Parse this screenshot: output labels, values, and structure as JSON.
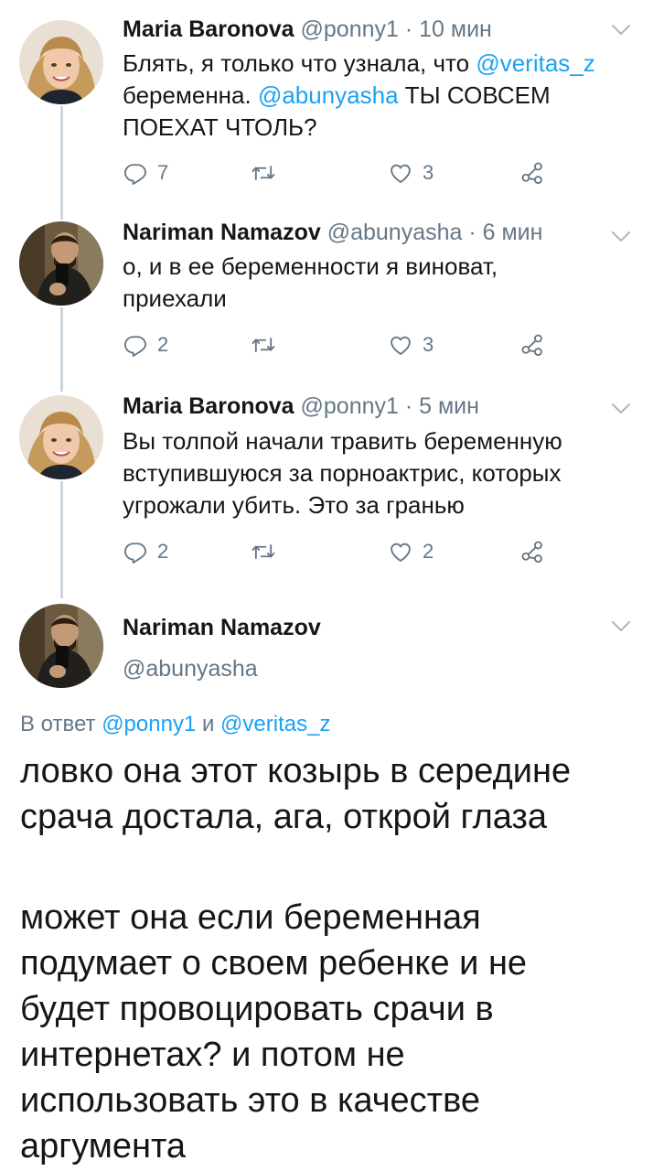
{
  "tweets": [
    {
      "name": "Maria Baronova",
      "handle": "@ponny1",
      "time": "· 10 мин",
      "text_parts": [
        "Блять, я только что узнала, что ",
        "@veritas_z",
        " беременна. ",
        "@abunyasha",
        " ТЫ СОВСЕМ ПОЕХАТ ЧТОЛЬ?"
      ],
      "replies": "7",
      "retweets": "",
      "likes": "3"
    },
    {
      "name": "Nariman Namazov",
      "handle": "@abunyasha",
      "time": "· 6 мин",
      "text": "о, и в ее беременности я виноват, приехали",
      "replies": "2",
      "retweets": "",
      "likes": "3"
    },
    {
      "name": "Maria Baronova",
      "handle": "@ponny1",
      "time": "· 5 мин",
      "text": "Вы толпой начали травить беременную вступившуюся за порноактрис, которых угрожали убить. Это за гранью",
      "replies": "2",
      "retweets": "",
      "likes": "2"
    }
  ],
  "focus": {
    "name": "Nariman Namazov",
    "handle": "@abunyasha",
    "reply_prefix": "В ответ ",
    "reply_mention1": "@ponny1",
    "reply_and": " и ",
    "reply_mention2": "@veritas_z",
    "paragraph1": "ловко она этот козырь в середине срача достала, ага, открой глаза",
    "paragraph2": "может она если беременная подумает о своем ребенке и не будет провоцировать срачи в интернетах? и потом не использовать это в качестве аргумента"
  },
  "colors": {
    "link": "#1da1f2",
    "meta": "#657786",
    "thread_line": "#ccd6dd"
  },
  "icons": [
    "reply-icon",
    "retweet-icon",
    "like-icon",
    "share-icon",
    "chevron-down-icon"
  ]
}
